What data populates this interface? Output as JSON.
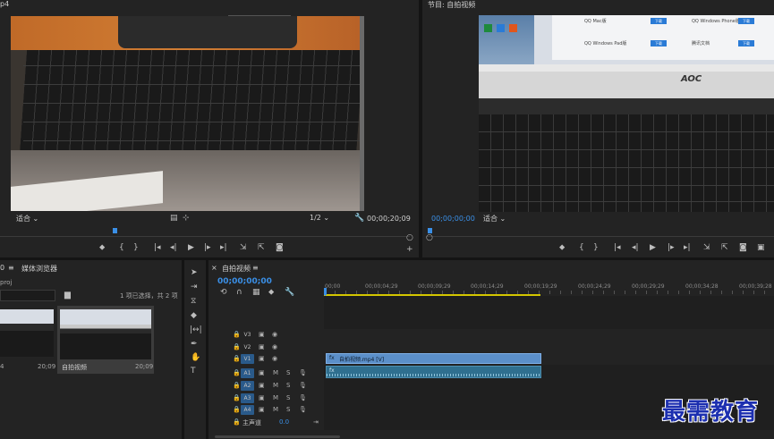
{
  "source_monitor": {
    "tab_label": "p4",
    "fit_label": "适合",
    "resolution": "1/2",
    "timecode": "00;00;20;09"
  },
  "program_monitor": {
    "tab_label": "节目: 自拍视频",
    "timecode": "00;00;00;00",
    "fit_label": "适合",
    "screen_brand": "AOC",
    "desktop_items": [
      "QQ Mac版",
      "QQ Windows Phone版",
      "QQ Windows Pad版",
      "腾讯文档"
    ],
    "download_label": "下载"
  },
  "project": {
    "tab_prefix": "0",
    "tab_label": "媒体浏览器",
    "file_label": "proj",
    "selection_info": "1 项已选择，共 2 项",
    "items": [
      {
        "name": "",
        "duration": "20;09",
        "badge": "4"
      },
      {
        "name": "自拍视频",
        "duration": "20;09"
      }
    ]
  },
  "timeline": {
    "tab_label": "自拍视频",
    "timecode": "00;00;00;00",
    "ruler": [
      "00;00",
      "00;00;04;29",
      "00;00;09;29",
      "00;00;14;29",
      "00;00;19;29",
      "00;00;24;29",
      "00;00;29;29",
      "00;00;34;28",
      "00;00;39;28"
    ],
    "video_tracks": [
      "V3",
      "V2",
      "V1"
    ],
    "audio_tracks": [
      "A1",
      "A2",
      "A3",
      "A4"
    ],
    "master_label": "主声道",
    "master_value": "0.0",
    "clip_label": "自拍视频.mp4 [V]",
    "track_m": "M",
    "track_s": "S"
  },
  "watermark": "最需教育",
  "colors": {
    "accent": "#3a8fe6",
    "video_clip": "#5b8fc9",
    "audio_clip": "#2f6f8f",
    "work_area": "#d4c600"
  }
}
